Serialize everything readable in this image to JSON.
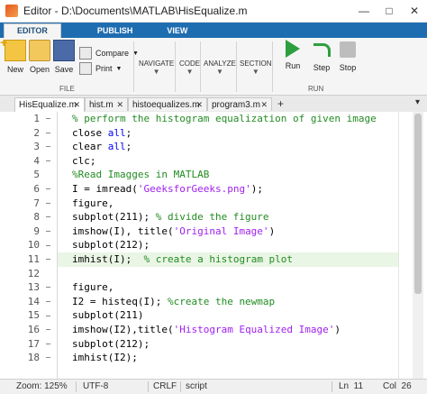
{
  "window": {
    "title": "Editor - D:\\Documents\\MATLAB\\HisEqualize.m",
    "controls": {
      "minimize": "—",
      "maximize": "□",
      "close": "✕"
    }
  },
  "ribbon": {
    "tabs": [
      {
        "label": "EDITOR",
        "active": true
      },
      {
        "label": "PUBLISH",
        "active": false
      },
      {
        "label": "VIEW",
        "active": false
      }
    ],
    "file_group": {
      "new": "New",
      "open": "Open",
      "save": "Save",
      "compare": "Compare",
      "print": "Print",
      "label": "FILE"
    },
    "collapsed": [
      "NAVIGATE",
      "CODE",
      "ANALYZE",
      "SECTION"
    ],
    "run_group": {
      "run": "Run",
      "step": "Step",
      "stop": "Stop",
      "label": "RUN"
    }
  },
  "file_tabs": [
    {
      "label": "HisEqualize.m",
      "active": true
    },
    {
      "label": "hist.m",
      "active": false
    },
    {
      "label": "histoequalizes.m",
      "active": false
    },
    {
      "label": "program3.m",
      "active": false
    }
  ],
  "editor": {
    "highlighted_line": 11,
    "lines": [
      {
        "n": "1",
        "text": "% perform the histogram equalization of given image"
      },
      {
        "n": "2",
        "text": "close all;"
      },
      {
        "n": "3",
        "text": "clear all;"
      },
      {
        "n": "4",
        "text": "clc;"
      },
      {
        "n": "5",
        "text": "%Read Imagges in MATLAB"
      },
      {
        "n": "6",
        "text": "I = imread('GeeksforGeeks.png');"
      },
      {
        "n": "7",
        "text": "figure,"
      },
      {
        "n": "8",
        "text": "subplot(211); % divide the figure"
      },
      {
        "n": "9",
        "text": "imshow(I), title('Original Image')"
      },
      {
        "n": "10",
        "text": "subplot(212);"
      },
      {
        "n": "11",
        "text": "imhist(I);  % create a histogram plot"
      },
      {
        "n": "12",
        "text": ""
      },
      {
        "n": "13",
        "text": "figure,"
      },
      {
        "n": "14",
        "text": "I2 = histeq(I); %create the newmap"
      },
      {
        "n": "15",
        "text": "subplot(211)"
      },
      {
        "n": "16",
        "text": "imshow(I2),title('Histogram Equalized Image')"
      },
      {
        "n": "17",
        "text": "subplot(212);"
      },
      {
        "n": "18",
        "text": "imhist(I2);"
      }
    ]
  },
  "status": {
    "zoom": "Zoom: 125%",
    "encoding": "UTF-8",
    "line_ending": "CRLF",
    "type": "script",
    "ln": "Ln  11",
    "col": "Col  26"
  }
}
